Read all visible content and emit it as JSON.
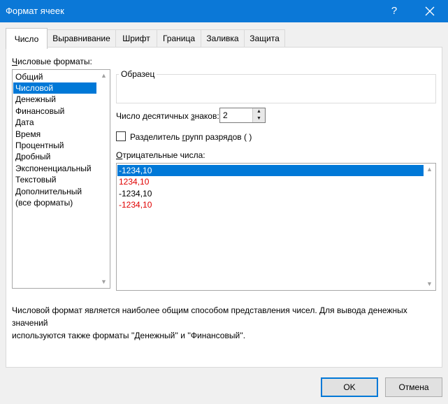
{
  "window": {
    "title": "Формат ячеек",
    "help_label": "?"
  },
  "tabs": [
    {
      "label": "Число",
      "active": true
    },
    {
      "label": "Выравнивание",
      "active": false
    },
    {
      "label": "Шрифт",
      "active": false
    },
    {
      "label": "Граница",
      "active": false
    },
    {
      "label": "Заливка",
      "active": false
    },
    {
      "label": "Защита",
      "active": false
    }
  ],
  "number_formats": {
    "label_first": "Ч",
    "label_rest": "исловые форматы:",
    "items": [
      "Общий",
      "Числовой",
      "Денежный",
      "Финансовый",
      "Дата",
      "Время",
      "Процентный",
      "Дробный",
      "Экспоненциальный",
      "Текстовый",
      "Дополнительный",
      "(все форматы)"
    ],
    "selected": "Числовой"
  },
  "sample": {
    "legend": "Образец"
  },
  "decimals": {
    "label_a": "Число десятичных ",
    "label_u": "з",
    "label_b": "наков:",
    "value": "2"
  },
  "separator": {
    "label_a": "Разделитель ",
    "label_u": "г",
    "label_b": "рупп разрядов ( )",
    "checked": false
  },
  "negative": {
    "label_u": "О",
    "label_rest": "трицательные числа:",
    "items": [
      {
        "text": "-1234,10",
        "color": "#000000",
        "selected": true
      },
      {
        "text": "1234,10",
        "color": "#e00000",
        "selected": false
      },
      {
        "text": "-1234,10",
        "color": "#000000",
        "selected": false
      },
      {
        "text": "-1234,10",
        "color": "#e00000",
        "selected": false
      }
    ]
  },
  "description": {
    "line1": "Числовой формат является наиболее общим способом представления чисел. Для вывода денежных значений",
    "line2": "используются также форматы ''Денежный'' и ''Финансовый''."
  },
  "buttons": {
    "ok": "OK",
    "cancel": "Отмена"
  },
  "colors": {
    "titlebar": "#0b78d7",
    "selection": "#0078d7",
    "negative_red": "#e00000"
  }
}
